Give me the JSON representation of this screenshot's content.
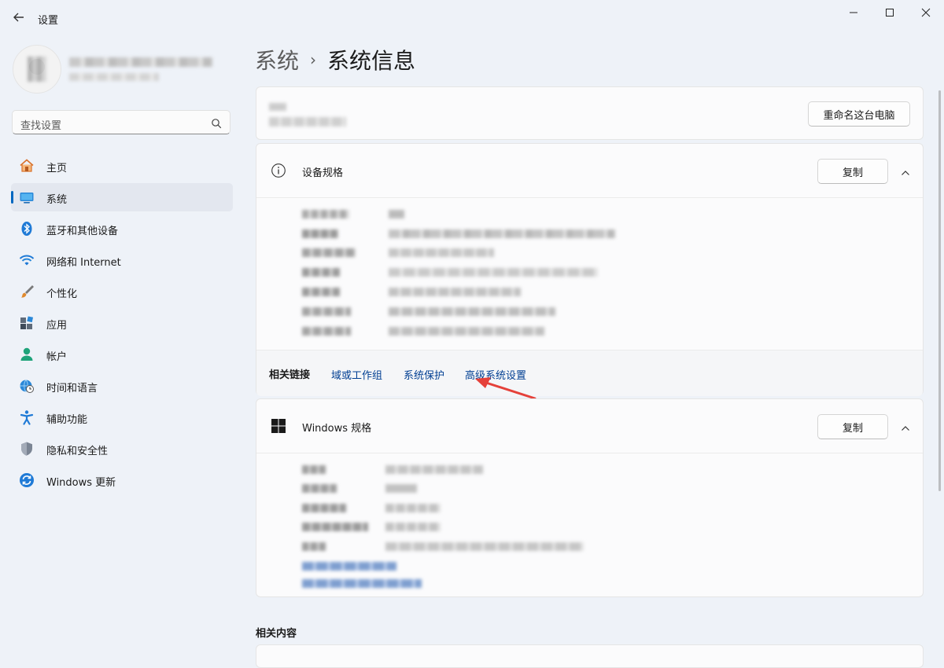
{
  "app": {
    "title": "设置"
  },
  "search": {
    "placeholder": "查找设置"
  },
  "nav": {
    "items": [
      {
        "label": "主页",
        "icon": "home-icon"
      },
      {
        "label": "系统",
        "icon": "monitor-icon"
      },
      {
        "label": "蓝牙和其他设备",
        "icon": "bluetooth-icon"
      },
      {
        "label": "网络和 Internet",
        "icon": "wifi-icon"
      },
      {
        "label": "个性化",
        "icon": "brush-icon"
      },
      {
        "label": "应用",
        "icon": "apps-icon"
      },
      {
        "label": "帐户",
        "icon": "account-icon"
      },
      {
        "label": "时间和语言",
        "icon": "globe-clock-icon"
      },
      {
        "label": "辅助功能",
        "icon": "accessibility-icon"
      },
      {
        "label": "隐私和安全性",
        "icon": "shield-icon"
      },
      {
        "label": "Windows 更新",
        "icon": "update-icon"
      }
    ],
    "active_index": 1
  },
  "breadcrumb": {
    "parent": "系统",
    "separator": "›",
    "current": "系统信息"
  },
  "pc_card": {
    "rename_button": "重命名这台电脑"
  },
  "device_spec": {
    "title": "设备规格",
    "copy_button": "复制",
    "related_label": "相关链接",
    "links": [
      "域或工作组",
      "系统保护",
      "高级系统设置"
    ]
  },
  "windows_spec": {
    "title": "Windows 规格",
    "copy_button": "复制"
  },
  "related_content": {
    "title": "相关内容"
  },
  "colors": {
    "accent": "#0067c0",
    "link": "#003e92",
    "annotation_arrow": "#e5413a"
  }
}
